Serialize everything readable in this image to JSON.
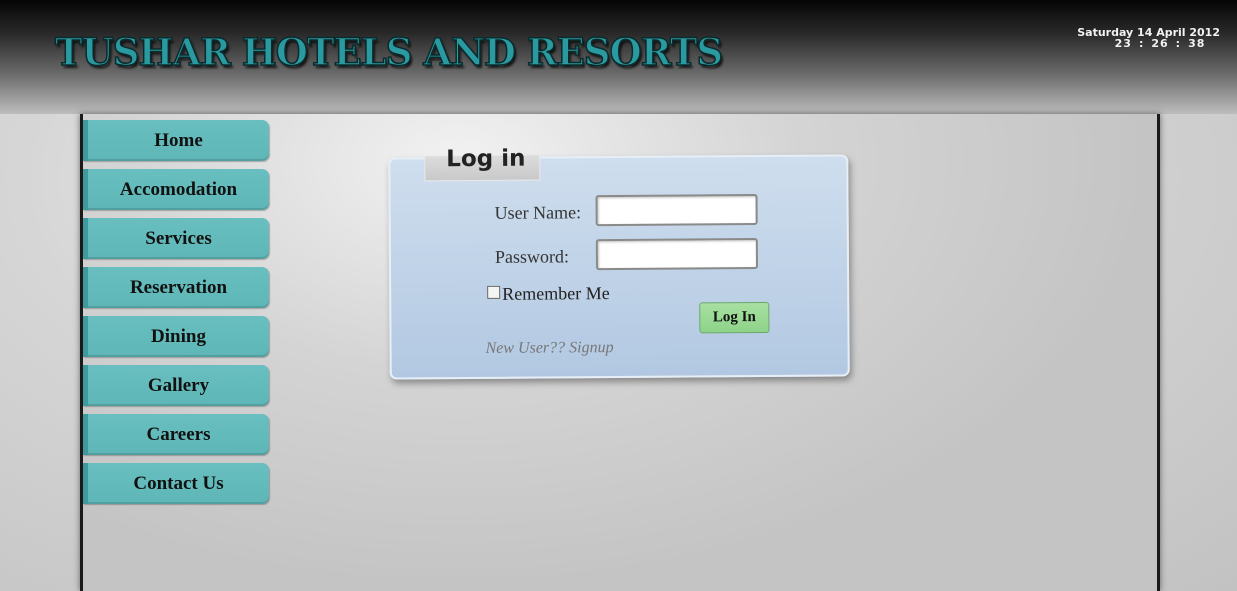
{
  "header": {
    "site_title": "TUSHAR HOTELS AND RESORTS",
    "date": "Saturday 14 April 2012",
    "time": {
      "hours": "23",
      "minutes": "26",
      "seconds": "38",
      "separator": ":"
    }
  },
  "nav": {
    "items": [
      {
        "label": "Home"
      },
      {
        "label": "Accomodation"
      },
      {
        "label": "Services"
      },
      {
        "label": "Reservation"
      },
      {
        "label": "Dining"
      },
      {
        "label": "Gallery"
      },
      {
        "label": "Careers"
      },
      {
        "label": "Contact Us"
      }
    ]
  },
  "login": {
    "title": "Log in",
    "username_label": "User Name:",
    "username_value": "",
    "password_label": "Password:",
    "password_value": "",
    "remember_label": "Remember Me",
    "remember_checked": false,
    "submit_label": "Log In",
    "signup_link": "New User?? Signup"
  },
  "colors": {
    "nav_button": "#62b9b9",
    "login_panel": "#c1d4ea",
    "login_button": "#98d893",
    "title_text": "#2a9aa0"
  }
}
